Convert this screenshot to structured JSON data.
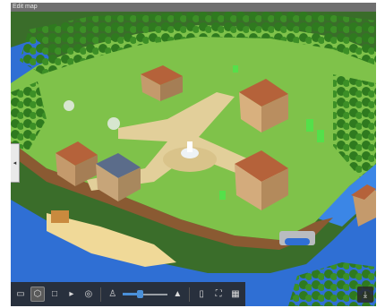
{
  "window": {
    "title": "Edit map"
  },
  "side_panel": {
    "toggle_glyph": "◂"
  },
  "toolbar": {
    "buttons": [
      {
        "icon": "camera-icon",
        "glyph": "▭"
      },
      {
        "icon": "cube-icon",
        "glyph": "⬡"
      },
      {
        "icon": "square-icon",
        "glyph": "□"
      },
      {
        "icon": "arrow-right-bar-icon",
        "glyph": "▸"
      },
      {
        "icon": "target-icon",
        "glyph": "◎"
      },
      {
        "icon": "person-pin-icon",
        "glyph": "♙"
      },
      {
        "icon": "mountain-icon",
        "glyph": "▲"
      },
      {
        "icon": "phone-icon",
        "glyph": "▯"
      },
      {
        "icon": "fullscreen-icon",
        "glyph": "⛶"
      },
      {
        "icon": "grid-icon",
        "glyph": "▦"
      }
    ],
    "zoom_level": 0.35
  },
  "export": {
    "icon": "export-tray-icon",
    "glyph": "⤓"
  },
  "colors": {
    "water": "#2f6fd4",
    "grass": "#7fc24a",
    "dirt": "#8a5a32",
    "path": "#e2cf9a",
    "roof": "#b5623a",
    "slider": "#4a90d9"
  }
}
